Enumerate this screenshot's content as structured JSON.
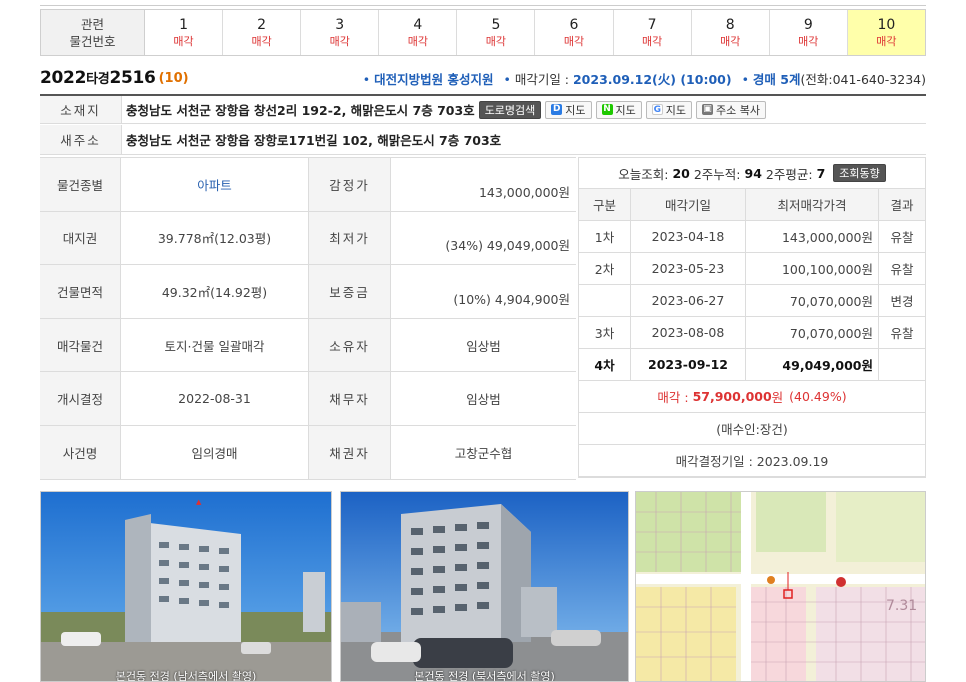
{
  "related": {
    "header_line1": "관련",
    "header_line2": "물건번호",
    "items": [
      {
        "num": "1",
        "status": "매각"
      },
      {
        "num": "2",
        "status": "매각"
      },
      {
        "num": "3",
        "status": "매각"
      },
      {
        "num": "4",
        "status": "매각"
      },
      {
        "num": "5",
        "status": "매각"
      },
      {
        "num": "6",
        "status": "매각"
      },
      {
        "num": "7",
        "status": "매각"
      },
      {
        "num": "8",
        "status": "매각"
      },
      {
        "num": "9",
        "status": "매각"
      },
      {
        "num": "10",
        "status": "매각"
      }
    ],
    "active_index": 9,
    "active_color": "#ffffaa"
  },
  "case": {
    "year": "2022",
    "type": "타경",
    "number": "2516",
    "item": "(10)",
    "court": "대전지방법원 홍성지원",
    "sale_date_label": "매각기일 :",
    "sale_date": "2023.09.12(火) (10:00)",
    "dept": "경매 5계",
    "phone": "(전화:041-640-3234)"
  },
  "address": {
    "label": "소재지",
    "value": "충청남도 서천군 장항읍 창선2리 192-2, 해맑은도시 7층 703호",
    "road_button": "도로명검색",
    "map_daum": "지도",
    "map_naver": "지도",
    "map_google": "지도",
    "copy_button": "주소 복사"
  },
  "new_address": {
    "label": "새주소",
    "value": "충청남도 서천군 장항읍 장항로171번길 102, 해맑은도시 7층 703호"
  },
  "info": [
    {
      "k1": "물건종별",
      "v1": "아파트",
      "k2": "감정가",
      "v2": "143,000,000원"
    },
    {
      "k1": "대지권",
      "v1": "39.778㎡(12.03평)",
      "k2": "최저가",
      "v2": "(34%) 49,049,000원"
    },
    {
      "k1": "건물면적",
      "v1": "49.32㎡(14.92평)",
      "k2": "보증금",
      "v2": "(10%) 4,904,900원"
    },
    {
      "k1": "매각물건",
      "v1": "토지·건물 일괄매각",
      "k2": "소유자",
      "v2": "임상범"
    },
    {
      "k1": "개시결정",
      "v1": "2022-08-31",
      "k2": "채무자",
      "v2": "임상범"
    },
    {
      "k1": "사건명",
      "v1": "임의경매",
      "k2": "채권자",
      "v2": "고창군수협"
    }
  ],
  "views": {
    "today_label": "오늘조회:",
    "today": "20",
    "two_week_label": "2주누적:",
    "two_week": "94",
    "avg_label": "2주평균:",
    "avg": "7",
    "trend_button": "조회동향"
  },
  "history": {
    "headers": [
      "구분",
      "매각기일",
      "최저매각가격",
      "결과"
    ],
    "rows": [
      {
        "round": "1차",
        "date": "2023-04-18",
        "price": "143,000,000원",
        "result": "유찰"
      },
      {
        "round": "2차",
        "date": "2023-05-23",
        "price": "100,100,000원",
        "result": "유찰"
      },
      {
        "round": "",
        "date": "2023-06-27",
        "price": "70,070,000원",
        "result": "변경"
      },
      {
        "round": "3차",
        "date": "2023-08-08",
        "price": "70,070,000원",
        "result": "유찰"
      },
      {
        "round": "4차",
        "date": "2023-09-12",
        "price": "49,049,000원",
        "result": ""
      }
    ]
  },
  "sale": {
    "label": "매각 :",
    "amount": "57,900,000",
    "unit": "원",
    "pct": "(40.49%)",
    "buyer": "(매수인:장건)",
    "decision": "매각결정기일 : 2023.09.19"
  },
  "photos": {
    "cap1": "본건동 전경 (남서측에서 촬영)",
    "cap2": "본건동 전경 (북서측에서 촬영)"
  },
  "colors": {
    "accent_blue": "#1f5fb8",
    "red": "#d33",
    "orange": "#e07000"
  }
}
